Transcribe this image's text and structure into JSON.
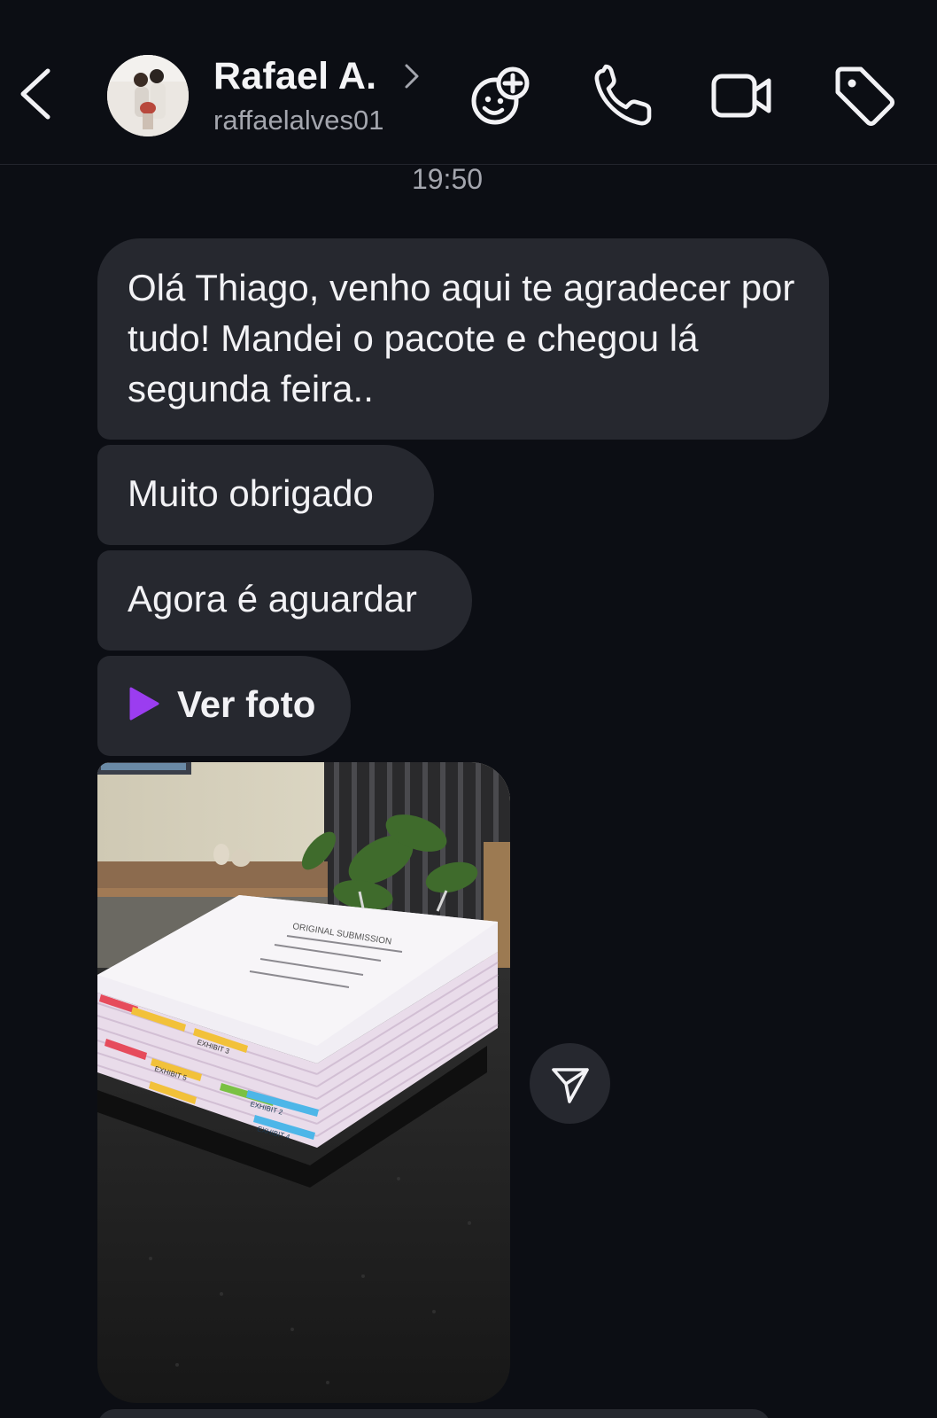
{
  "header": {
    "back_icon": "chevron-left-icon",
    "contact_name": "Rafael A.",
    "username": "raffaelalves01",
    "actions": [
      {
        "name": "effects-icon"
      },
      {
        "name": "phone-icon"
      },
      {
        "name": "video-icon"
      },
      {
        "name": "tag-icon"
      }
    ]
  },
  "thread": {
    "timestamp": "19:50",
    "messages": [
      {
        "text": "Olá Thiago, venho aqui te agradecer por tudo! Mandei o pacote e chegou lá segunda feira.."
      },
      {
        "text": "Muito obrigado"
      },
      {
        "text": "Agora é aguardar"
      },
      {
        "text": "Ver foto",
        "icon": "play-icon",
        "icon_color": "#9b3df0"
      }
    ],
    "photo": {
      "label_top": "ORIGINAL SUBMISSION",
      "tabs": [
        "EXHIBIT 3",
        "EXHIBIT 5",
        "EXHIBIT 2",
        "EXHIBIT 4"
      ]
    },
    "share_icon": "send-icon"
  },
  "colors": {
    "background": "#0c0e14",
    "bubble": "#26282f",
    "text": "#f2f2f5",
    "muted": "#a4a6ae",
    "accent": "#9b3df0"
  }
}
